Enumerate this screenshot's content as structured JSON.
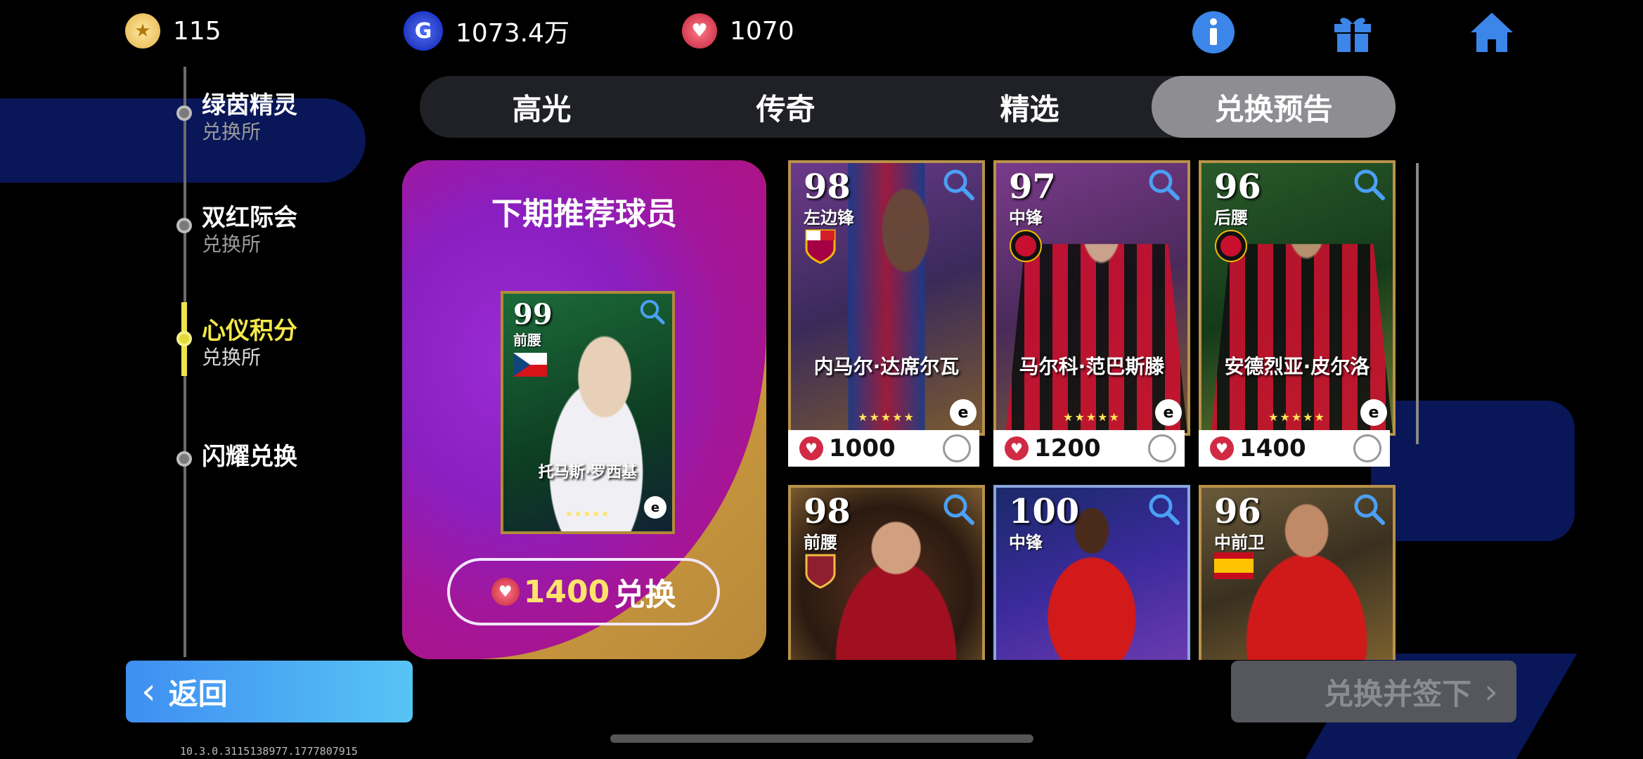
{
  "currency": {
    "coins": "115",
    "gp": "1073.4万",
    "hearts": "1070"
  },
  "sidebar": {
    "items": [
      {
        "title": "绿茵精灵",
        "subtitle": "兑换所"
      },
      {
        "title": "双红际会",
        "subtitle": "兑换所"
      },
      {
        "title": "心仪积分",
        "subtitle": "兑换所"
      },
      {
        "title": "闪耀兑换",
        "subtitle": ""
      }
    ],
    "active_index": 2
  },
  "tabs": [
    "高光",
    "传奇",
    "精选",
    "兑换预告"
  ],
  "selected_tab": "兑换预告",
  "recommended": {
    "title": "下期推荐球员",
    "player": {
      "rating": "99",
      "position": "前腰",
      "name": "托马斯·罗西基"
    },
    "price": "1400",
    "button_label": "兑换"
  },
  "players": [
    {
      "rating": "98",
      "position": "左边锋",
      "name": "内马尔·达席尔瓦",
      "price": "1000"
    },
    {
      "rating": "97",
      "position": "中锋",
      "name": "马尔科·范巴斯滕",
      "price": "1200"
    },
    {
      "rating": "96",
      "position": "后腰",
      "name": "安德烈亚·皮尔洛",
      "price": "1400"
    },
    {
      "rating": "98",
      "position": "前腰",
      "name": "",
      "price": ""
    },
    {
      "rating": "100",
      "position": "中锋",
      "name": "",
      "price": ""
    },
    {
      "rating": "96",
      "position": "中前卫",
      "name": "",
      "price": ""
    }
  ],
  "buttons": {
    "back": "返回",
    "sign": "兑换并签下"
  },
  "version": "10.3.0.3115138977.1777807915",
  "colors": {
    "accent_blue": "#4a9cf3",
    "active_yellow": "#f4e84a",
    "heart_red": "#d12a45"
  }
}
